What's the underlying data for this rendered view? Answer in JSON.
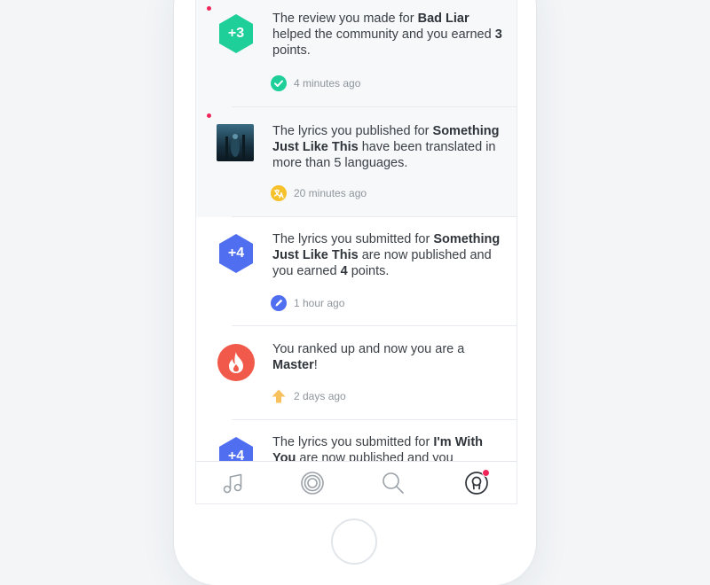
{
  "colors": {
    "green": "#1fcf99",
    "blue": "#4f6ef0",
    "red": "#f15a4a",
    "amber": "#f6c12a",
    "unread_dot": "#f0255a"
  },
  "notifications": [
    {
      "unread": true,
      "badge": "+3",
      "msg_pre": "The review you made for ",
      "msg_bold": "Bad Liar",
      "msg_mid": " helped the community and you earned ",
      "msg_bold2": "3",
      "msg_post": " points.",
      "time": "4 minutes ago",
      "icon": "check-circle-icon"
    },
    {
      "unread": true,
      "msg_pre": "The lyrics you published for ",
      "msg_bold": "Something Just Like This",
      "msg_post": " have been translated in more than 5 languages.",
      "time": "20 minutes ago",
      "icon": "translate-icon"
    },
    {
      "unread": false,
      "badge": "+4",
      "msg_pre": "The lyrics you submitted for ",
      "msg_bold": "Something Just Like This",
      "msg_mid": " are now published and you earned ",
      "msg_bold2": "4",
      "msg_post": " points.",
      "time": "1 hour ago",
      "icon": "pencil-circle-icon"
    },
    {
      "unread": false,
      "msg_pre": "You ranked up and now you are a ",
      "msg_bold": "Master",
      "msg_post": "!",
      "time": "2 days ago",
      "icon": "arrow-up-icon"
    },
    {
      "unread": false,
      "badge": "+4",
      "msg_pre": "The lyrics you submitted for ",
      "msg_bold": "I'm With You",
      "msg_post": " are now published and you"
    }
  ],
  "tabbar": {
    "tabs": [
      "music-note-icon",
      "record-icon",
      "search-icon",
      "profile-icon"
    ]
  }
}
